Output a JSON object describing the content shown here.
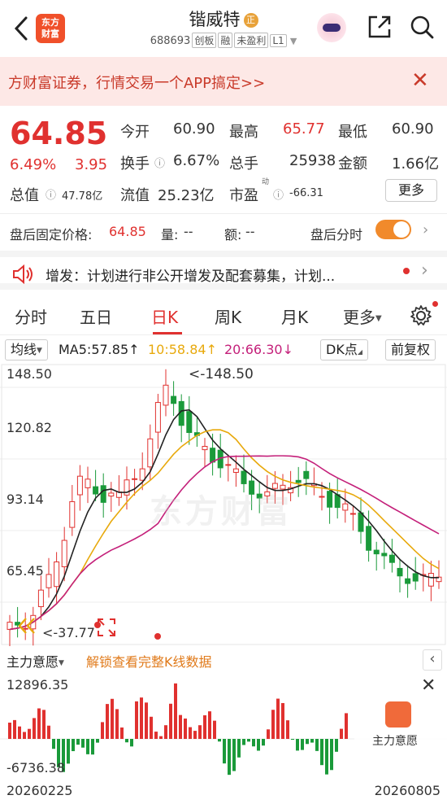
{
  "header": {
    "logo_line1": "东方",
    "logo_line2": "财富",
    "stock_name": "锴威特",
    "stock_tag": "正",
    "code": "688693",
    "board_tags": [
      "创板",
      "融",
      "未盈利",
      "L1"
    ]
  },
  "banner": {
    "text": "方财富证券，行情交易一个APP搞定>>",
    "close": "✕"
  },
  "quote": {
    "price": "64.85",
    "change_pct": "6.49%",
    "change_amt": "3.95",
    "today_open_label": "今开",
    "today_open": "60.90",
    "high_label": "最高",
    "high": "65.77",
    "low_label": "最低",
    "low": "60.90",
    "turnover_label": "换手",
    "turnover": "6.67%",
    "volume_label": "总手",
    "volume": "25938",
    "amount_label": "金额",
    "amount": "1.66亿",
    "total_cap_label": "总值",
    "total_cap": "47.78亿",
    "float_cap_label": "流值",
    "float_cap": "25.23亿",
    "pe_label": "市盈",
    "pe_sup": "动",
    "pe": "-66.31",
    "more_label": "更多"
  },
  "after_hours": {
    "fixed_price_label": "盘后固定价格:",
    "fixed_price": "64.85",
    "qty_label": "量:",
    "qty": "--",
    "amt_label": "额:",
    "amt": "--",
    "timeshare_label": "盘后分时",
    "timeshare_on": true
  },
  "notice": {
    "text": "增发：计划进行非公开增发及配套募集，计划..."
  },
  "tabs": [
    "分时",
    "五日",
    "日K",
    "周K",
    "月K",
    "更多"
  ],
  "active_tab": "日K",
  "ma": {
    "type_label": "均线",
    "ma5": "MA5:57.85",
    "ma10": "10:58.84",
    "ma20": "20:66.30",
    "ma5_arrow": "↑",
    "ma10_arrow": "↑",
    "ma20_arrow": "↓",
    "dk_label": "DK点",
    "adjust_label": "前复权",
    "ma5_color": "#222222",
    "ma10_color": "#e8a90c",
    "ma20_color": "#c4207a"
  },
  "kline": {
    "y_ticks": [
      "148.50",
      "120.82",
      "93.14",
      "65.45",
      "37.77"
    ],
    "high_marker": "<-148.50",
    "low_marker": "<-37.77",
    "watermark": "东方财富",
    "up_color": "#e0312f",
    "down_color": "#1a9a3a"
  },
  "indicator": {
    "label": "主力意愿",
    "unlock_text": "解锁查看完整K线数据",
    "y_max": "12896.35",
    "y_min": "-6736.38",
    "badge_label": "主力意愿"
  },
  "dates": {
    "start": "20260225",
    "end": "20260805"
  }
}
